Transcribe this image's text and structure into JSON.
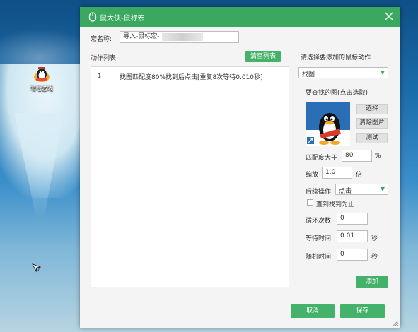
{
  "desktop": {
    "icon_label": "嘻哈游戏"
  },
  "dialog": {
    "title": "鼠大侠-鼠标宏",
    "macro_name_label": "宏名称:",
    "macro_name_value": "导入-鼠标宏-",
    "action_list_label": "动作列表",
    "clear_list_button": "清空列表",
    "actions": [
      {
        "index": "1",
        "text": "找图匹配度80%找到后点击[重复8次等待0.010秒]"
      }
    ],
    "add_action_label": "请选择要添加的鼠标动作",
    "action_type": {
      "selected": "找图"
    },
    "find_image_label": "要查找的图(点击选取)",
    "buttons": {
      "select": "选择",
      "clear_image": "清除图片",
      "test": "测试",
      "add": "添加",
      "cancel": "取消",
      "save": "保存"
    },
    "match": {
      "label": "匹配度大于",
      "value": "80",
      "unit": "%"
    },
    "scale": {
      "label": "缩放",
      "value": "1.0",
      "unit": "倍"
    },
    "follow_up": {
      "label": "后续操作",
      "selected": "点击"
    },
    "until_found": {
      "label": "直到找到为止",
      "checked": false
    },
    "loop": {
      "label": "循环次数",
      "value": "0"
    },
    "wait": {
      "label": "等待时间",
      "value": "0.01",
      "unit": "秒"
    },
    "random": {
      "label": "随机时间",
      "value": "0",
      "unit": "秒"
    }
  },
  "colors": {
    "accent": "#3aa95f",
    "button_green": "#45b26b"
  }
}
